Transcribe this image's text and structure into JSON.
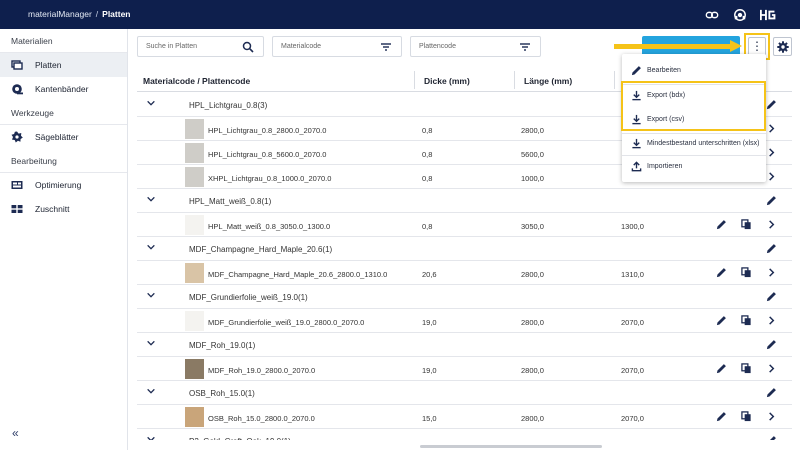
{
  "header": {
    "app": "materialManager",
    "separator": "/",
    "page": "Platten",
    "icons": [
      "link-icon",
      "support-icon",
      "hg-logo"
    ]
  },
  "sidebar": {
    "groups": [
      {
        "label": "Materialien",
        "items": [
          {
            "label": "Platten",
            "icon": "sheet-stack-icon",
            "active": true
          },
          {
            "label": "Kantenbänder",
            "icon": "edgeband-roll-icon"
          }
        ]
      },
      {
        "label": "Werkzeuge",
        "items": [
          {
            "label": "Sägeblätter",
            "icon": "sawblade-icon"
          }
        ]
      },
      {
        "label": "Bearbeitung",
        "items": [
          {
            "label": "Optimierung",
            "icon": "optimization-icon"
          },
          {
            "label": "Zuschnitt",
            "icon": "cutting-icon"
          }
        ]
      }
    ],
    "collapse": "«"
  },
  "filters": {
    "search_placeholder": "Suche in Platten",
    "materialcode_placeholder": "Materialcode",
    "plattencode_placeholder": "Plattencode"
  },
  "table": {
    "headers": {
      "code": "Materialcode / Plattencode",
      "dicke": "Dicke (mm)",
      "laenge": "Länge (mm)"
    },
    "rows": [
      {
        "type": "group",
        "name": "HPL_Lichtgrau_0.8",
        "count": "(3)"
      },
      {
        "type": "item",
        "code": "HPL_Lichtgrau_0.8_2800.0_2070.0",
        "dicke": "0,8",
        "laenge": "2800,0",
        "breite": ""
      },
      {
        "type": "item",
        "code": "HPL_Lichtgrau_0.8_5600.0_2070.0",
        "dicke": "0,8",
        "laenge": "5600,0",
        "breite": ""
      },
      {
        "type": "item",
        "code": "XHPL_Lichtgrau_0.8_1000.0_2070.0",
        "dicke": "0,8",
        "laenge": "1000,0",
        "breite": ""
      },
      {
        "type": "group",
        "name": "HPL_Matt_weiß_0.8",
        "count": "(1)"
      },
      {
        "type": "item",
        "code": "HPL_Matt_weiß_0.8_3050.0_1300.0",
        "dicke": "0,8",
        "laenge": "3050,0",
        "breite": "1300,0"
      },
      {
        "type": "group",
        "name": "MDF_Champagne_Hard_Maple_20.6",
        "count": "(1)"
      },
      {
        "type": "item",
        "code": "MDF_Champagne_Hard_Maple_20.6_2800.0_1310.0",
        "dicke": "20,6",
        "laenge": "2800,0",
        "breite": "1310,0"
      },
      {
        "type": "group",
        "name": "MDF_Grundierfolie_weiß_19.0",
        "count": "(1)"
      },
      {
        "type": "item",
        "code": "MDF_Grundierfolie_weiß_19.0_2800.0_2070.0",
        "dicke": "19,0",
        "laenge": "2800,0",
        "breite": "2070,0"
      },
      {
        "type": "group",
        "name": "MDF_Roh_19.0",
        "count": "(1)"
      },
      {
        "type": "item",
        "code": "MDF_Roh_19.0_2800.0_2070.0",
        "dicke": "19,0",
        "laenge": "2800,0",
        "breite": "2070,0"
      },
      {
        "type": "group",
        "name": "OSB_Roh_15.0",
        "count": "(1)"
      },
      {
        "type": "item",
        "code": "OSB_Roh_15.0_2800.0_2070.0",
        "dicke": "15,0",
        "laenge": "2800,0",
        "breite": "2070,0"
      },
      {
        "type": "group",
        "name": "P2_Gold_Craft_Oak_19.0",
        "count": "(1)"
      }
    ]
  },
  "menu": {
    "items": [
      {
        "label": "Bearbeiten",
        "icon": "pencil-icon"
      },
      {
        "label": "Export (bdx)",
        "icon": "download-icon"
      },
      {
        "label": "Export (csv)",
        "icon": "download-icon"
      },
      {
        "label": "Mindestbestand unterschritten (xlsx)",
        "icon": "download-icon"
      },
      {
        "label": "Importieren",
        "icon": "upload-icon"
      }
    ]
  },
  "colors": {
    "header_bg": "#0e1f4d",
    "accent_blue": "#24a4de",
    "highlight_yellow": "#f5c318",
    "swatches": [
      "#cfcdc8",
      "#cfcdc8",
      "#cfcdc8",
      "#f4f3f0",
      "#d9c4a6",
      "#f4f3f0",
      "#8a7a64",
      "#c9a57a"
    ]
  }
}
